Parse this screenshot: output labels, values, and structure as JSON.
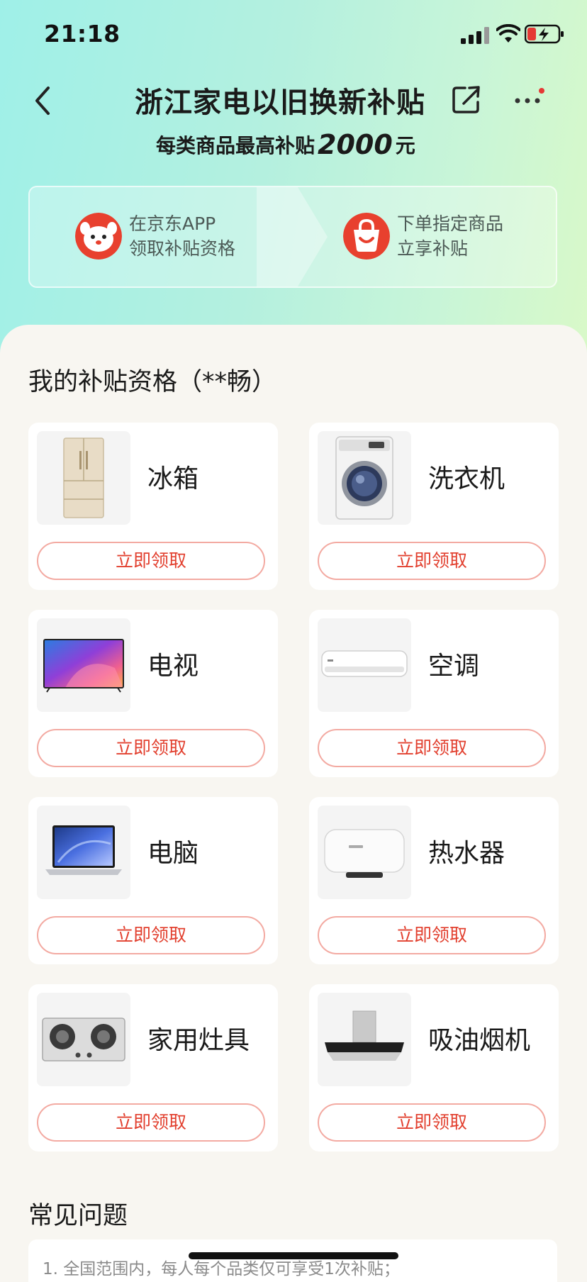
{
  "status_bar": {
    "time": "21:18"
  },
  "header": {
    "title": "浙江家电以旧换新补贴",
    "subtitle_prefix": "每类商品最高补贴",
    "subtitle_amount": "2000",
    "subtitle_suffix": "元"
  },
  "steps": [
    {
      "line1": "在京东APP",
      "line2": "领取补贴资格",
      "icon": "jd-mascot-icon"
    },
    {
      "line1": "下单指定商品",
      "line2": "立享补贴",
      "icon": "shopping-bag-icon"
    }
  ],
  "qualification": {
    "title": "我的补贴资格（**畅）",
    "items": [
      {
        "name": "冰箱",
        "button": "立即领取",
        "icon": "fridge-icon"
      },
      {
        "name": "洗衣机",
        "button": "立即领取",
        "icon": "washing-machine-icon"
      },
      {
        "name": "电视",
        "button": "立即领取",
        "icon": "tv-icon"
      },
      {
        "name": "空调",
        "button": "立即领取",
        "icon": "air-conditioner-icon"
      },
      {
        "name": "电脑",
        "button": "立即领取",
        "icon": "laptop-icon"
      },
      {
        "name": "热水器",
        "button": "立即领取",
        "icon": "water-heater-icon"
      },
      {
        "name": "家用灶具",
        "button": "立即领取",
        "icon": "gas-stove-icon"
      },
      {
        "name": "吸油烟机",
        "button": "立即领取",
        "icon": "range-hood-icon"
      }
    ]
  },
  "faq": {
    "title": "常见问题",
    "first_line": "1. 全国范围内，每人每个品类仅可享受1次补贴；"
  },
  "colors": {
    "accent": "#e2402f",
    "button_border": "#f3aaa2",
    "hero_start": "#9ff0e8",
    "hero_end": "#d9f9c8"
  }
}
